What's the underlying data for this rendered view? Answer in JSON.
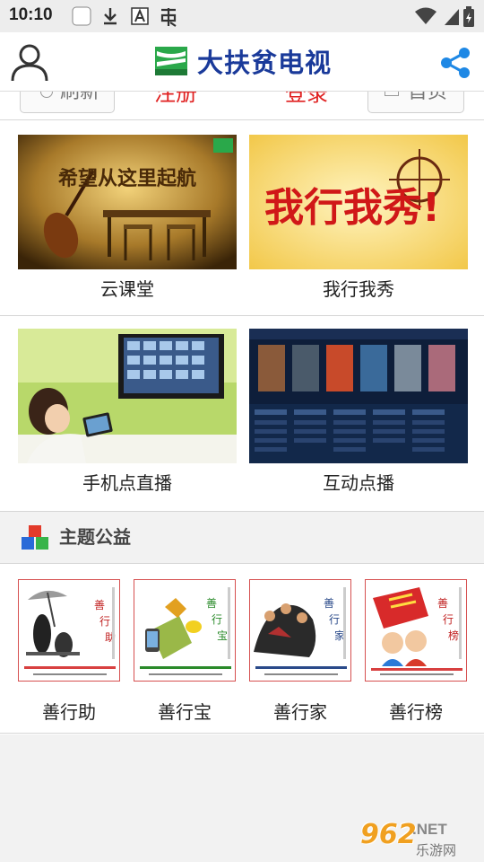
{
  "status_bar": {
    "time": "10:10"
  },
  "header": {
    "title": "大扶贫电视"
  },
  "top_row": {
    "refresh_label": "刷新",
    "register_label": "注册",
    "login_label": "登录",
    "home_label": "首页"
  },
  "tiles": [
    {
      "label": "云课堂",
      "image_text": "希望从这里起航"
    },
    {
      "label": "我行我秀",
      "image_text": "我行我秀!"
    },
    {
      "label": "手机点直播"
    },
    {
      "label": "互动点播"
    }
  ],
  "theme_section": {
    "title": "主题公益"
  },
  "charity": [
    {
      "label": "善行助",
      "card_chars": [
        "善",
        "行",
        "助"
      ]
    },
    {
      "label": "善行宝",
      "card_chars": [
        "善",
        "行",
        "宝"
      ]
    },
    {
      "label": "善行家",
      "card_chars": [
        "善",
        "行",
        "家"
      ]
    },
    {
      "label": "善行榜",
      "card_chars": [
        "善",
        "行",
        "榜"
      ]
    }
  ],
  "watermark": {
    "number": "962",
    "net": ".NET",
    "site": "乐游网"
  },
  "colors": {
    "brand_blue": "#1a3a9a",
    "accent_red": "#e02020",
    "share_blue": "#1e88e5"
  }
}
